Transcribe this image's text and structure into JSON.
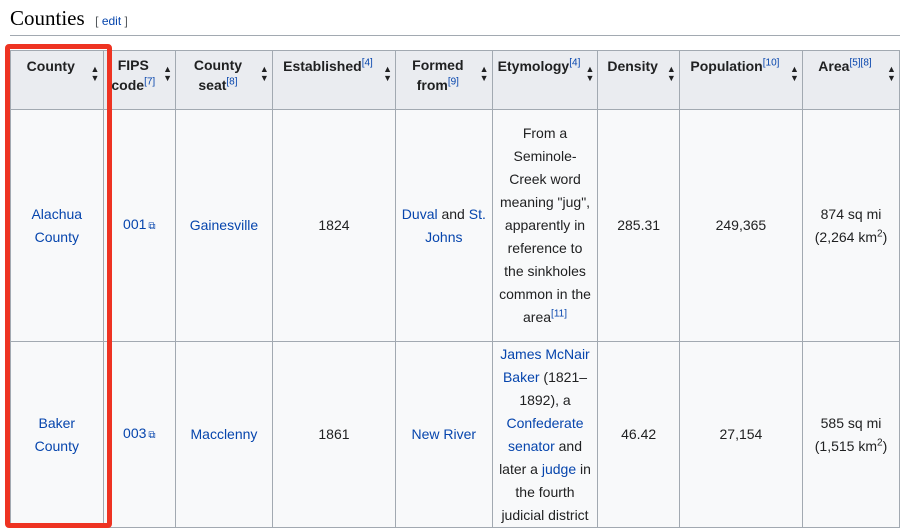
{
  "section": {
    "title": "Counties",
    "edit_open": "[",
    "edit_label": "edit",
    "edit_close": "]"
  },
  "columns": [
    {
      "label": "County",
      "sup": ""
    },
    {
      "label": "FIPS code",
      "sup": "[7]"
    },
    {
      "label": "County seat",
      "sup": "[8]"
    },
    {
      "label": "Established",
      "sup": "[4]"
    },
    {
      "label": "Formed from",
      "sup": "[9]"
    },
    {
      "label": "Etymology",
      "sup": "[4]"
    },
    {
      "label": "Density",
      "sup": ""
    },
    {
      "label": "Population",
      "sup": "[10]"
    },
    {
      "label": "Area",
      "sup": "[5][8]"
    }
  ],
  "rows": [
    {
      "county": "Alachua County",
      "fips": "001",
      "seat": "Gainesville",
      "established": "1824",
      "formed_from_1": "Duval",
      "formed_from_and": " and ",
      "formed_from_2": "St. Johns",
      "etymology": "From a Seminole-Creek word meaning \"jug\", apparently in reference to the sinkholes common in the area",
      "etymology_sup": "[11]",
      "density": "285.31",
      "population": "249,365",
      "area_mi": "874 sq mi",
      "area_km": "(2,264 km",
      "area_km_sup": "2",
      "area_km_close": ")"
    },
    {
      "county": "Baker County",
      "fips": "003",
      "seat": "Macclenny",
      "established": "1861",
      "formed_from": "New River",
      "ety_link1": "James McNair Baker",
      "ety_text1": " (1821–1892), a ",
      "ety_link2": "Confederate senator",
      "ety_text2": " and later a ",
      "ety_link3": "judge",
      "ety_text3": " in the fourth judicial district",
      "density": "46.42",
      "population": "27,154",
      "area_mi": "585 sq mi",
      "area_km": "(1,515 km",
      "area_km_sup": "2",
      "area_km_close": ")"
    }
  ],
  "colors": {
    "link": "#0645ad",
    "header_bg": "#eaecf0",
    "cell_bg": "#f8f9fa",
    "border": "#a2a9b1",
    "highlight": "#ee3322"
  },
  "icons": {
    "sort": "sort-arrows-icon",
    "external": "external-link-icon"
  }
}
